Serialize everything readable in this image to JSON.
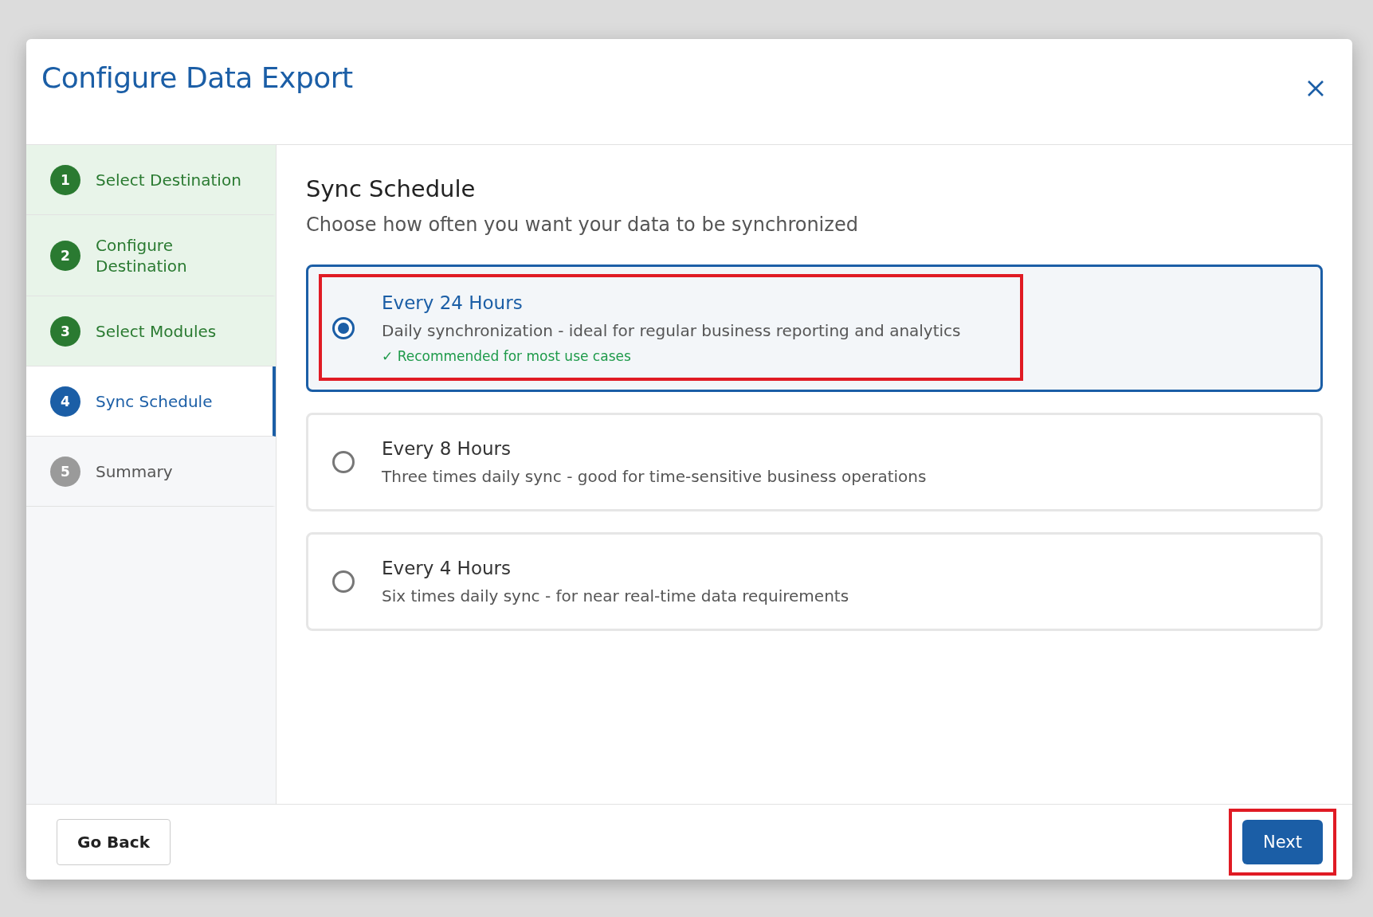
{
  "dialog": {
    "title": "Configure Data Export"
  },
  "steps": [
    {
      "number": "1",
      "label": "Select Destination",
      "completed": true,
      "selected": false
    },
    {
      "number": "2",
      "label": "Configure Destination",
      "completed": true,
      "selected": false
    },
    {
      "number": "3",
      "label": "Select Modules",
      "completed": true,
      "selected": false
    },
    {
      "number": "4",
      "label": "Sync Schedule",
      "completed": false,
      "selected": true
    },
    {
      "number": "5",
      "label": "Summary",
      "completed": false,
      "selected": false
    }
  ],
  "section": {
    "title": "Sync Schedule",
    "subtitle": "Choose how often you want your data to be synchronized"
  },
  "options": [
    {
      "title": "Every 24 Hours",
      "description": "Daily synchronization - ideal for regular business reporting and analytics",
      "note": "✓ Recommended for most use cases",
      "selected": true,
      "highlighted": true
    },
    {
      "title": "Every 8 Hours",
      "description": "Three times daily sync - good for time-sensitive business operations",
      "selected": false,
      "highlighted": false
    },
    {
      "title": "Every 4 Hours",
      "description": "Six times daily sync - for near real-time data requirements",
      "selected": false,
      "highlighted": false
    }
  ],
  "footer": {
    "back": {
      "label": "Go Back"
    },
    "next": {
      "label": "Next",
      "highlighted": true
    }
  }
}
